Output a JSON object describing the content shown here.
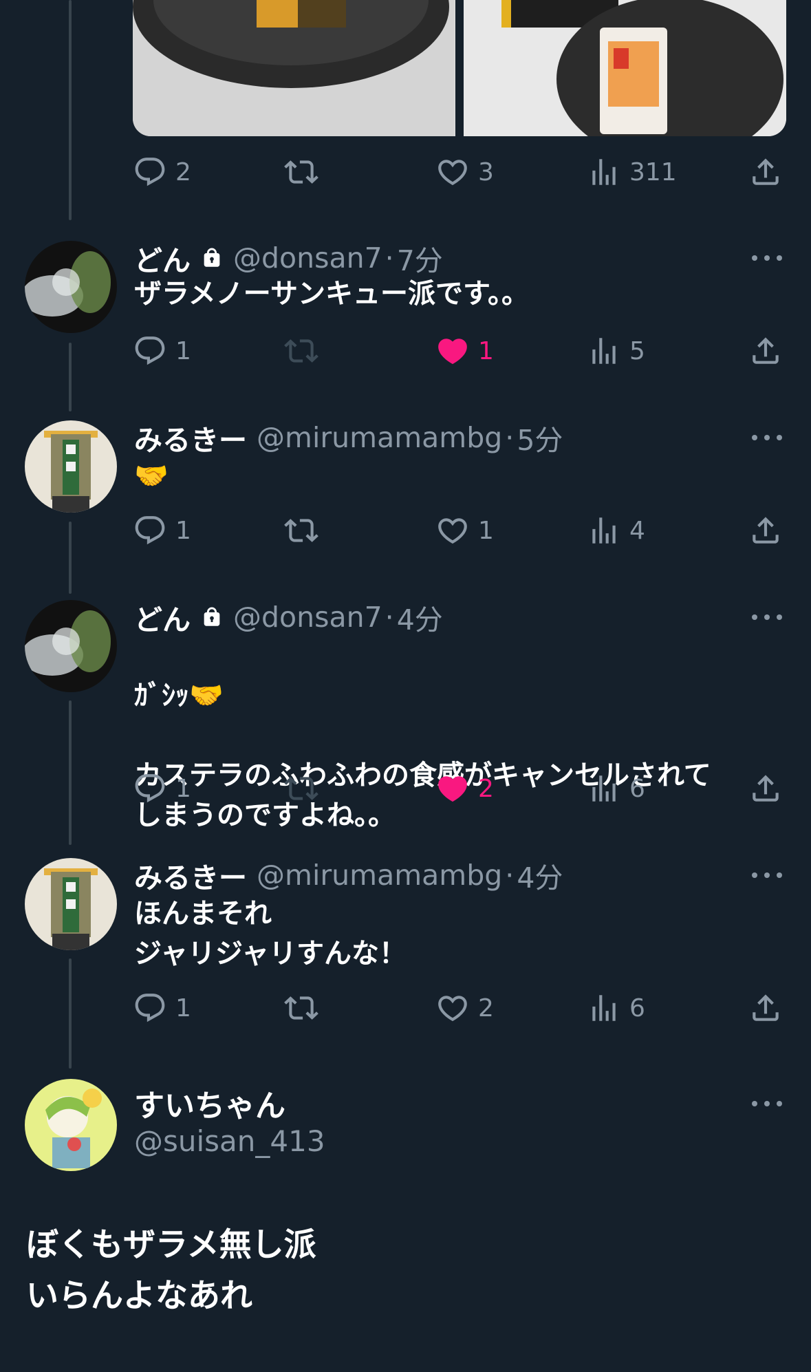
{
  "top_tweet": {
    "actions": {
      "reply_count": "2",
      "like_count": "3",
      "views_count": "311"
    }
  },
  "replies": [
    {
      "name": "どん",
      "handle": "@donsan7",
      "separator": "·",
      "time": "7分",
      "text": "ザラメノーサンキュー派です。。",
      "reply_count": "1",
      "like_count": "1",
      "views_count": "5",
      "liked": true
    },
    {
      "name": "みるきー",
      "handle": "@mirumamambg",
      "separator": "·",
      "time": "5分",
      "text": "🤝",
      "reply_count": "1",
      "like_count": "1",
      "views_count": "4",
      "liked": false
    },
    {
      "name": "どん",
      "handle": "@donsan7",
      "separator": "·",
      "time": "4分",
      "text_line1": "ｶﾞｼｯ",
      "text_rest": "カステラのふわふわの食感がキャンセルされて\nしまうのですよね。。",
      "reply_count": "1",
      "like_count": "2",
      "views_count": "6",
      "liked": true
    },
    {
      "name": "みるきー",
      "handle": "@mirumamambg",
      "separator": "·",
      "time": "4分",
      "text": "ほんまそれ\nジャリジャリすんな！",
      "reply_count": "1",
      "like_count": "2",
      "views_count": "6",
      "liked": false
    }
  ],
  "main_tweet": {
    "name": "すいちゃん",
    "handle": "@suisan_413",
    "text": "ぼくもザラメ無し派\nいらんよなあれ"
  },
  "colors": {
    "background": "#15202b",
    "muted": "#8b98a5",
    "like": "#f91880",
    "thread_line": "#38444d"
  },
  "icons": [
    "reply-icon",
    "retweet-icon",
    "like-icon",
    "views-icon",
    "share-icon",
    "lock-icon",
    "more-icon"
  ]
}
